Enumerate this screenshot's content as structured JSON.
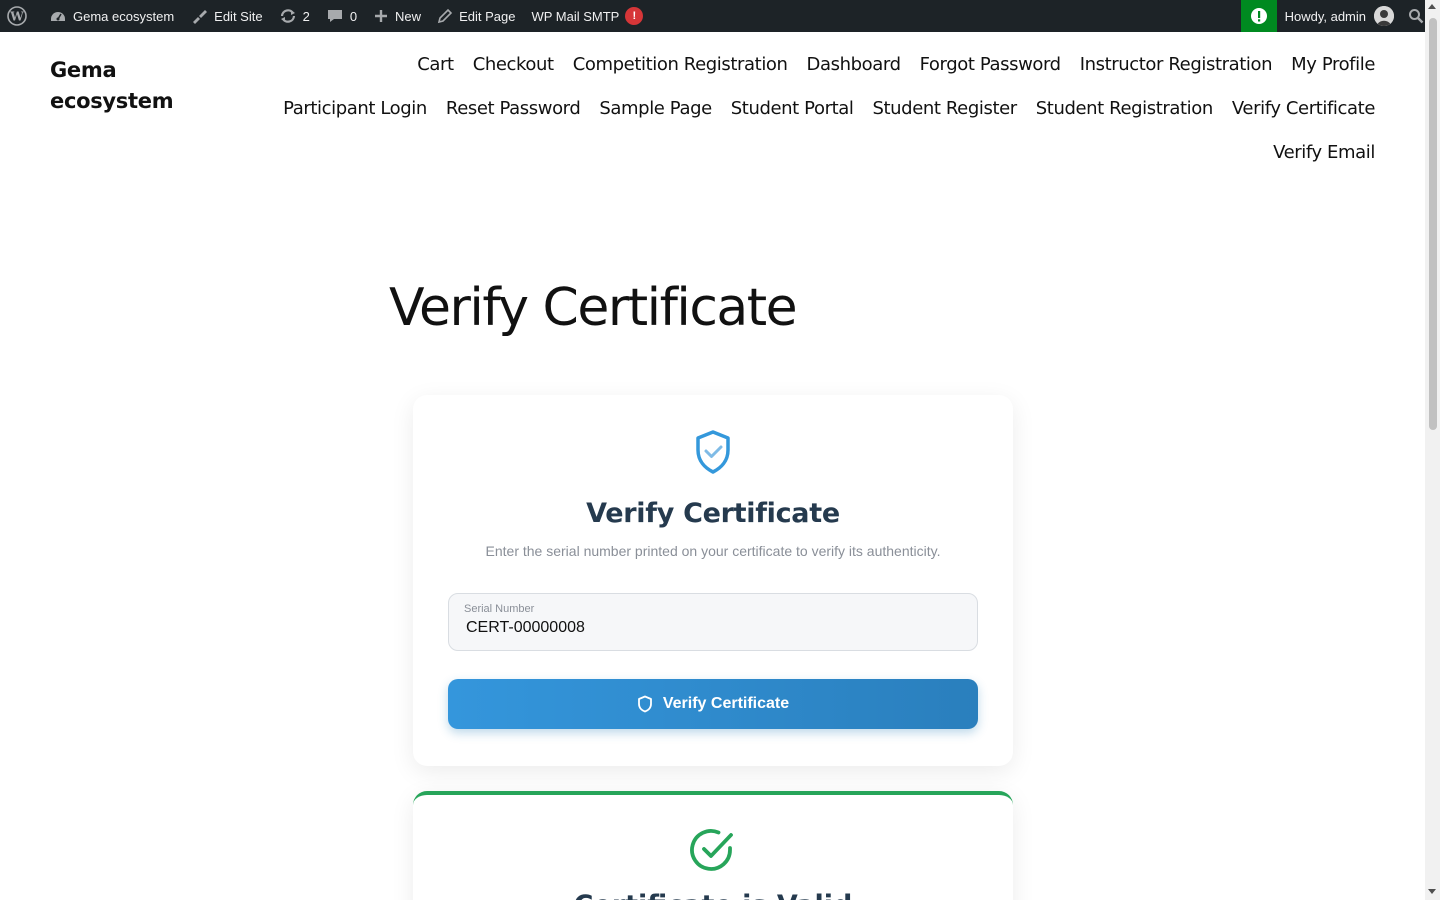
{
  "adminbar": {
    "site_name": "Gema ecosystem",
    "edit_site": "Edit Site",
    "updates_count": "2",
    "comments_count": "0",
    "new_label": "New",
    "edit_page": "Edit Page",
    "smtp_label": "WP Mail SMTP",
    "smtp_badge": "!",
    "howdy": "Howdy, admin"
  },
  "site": {
    "title": "Gema ecosystem"
  },
  "nav": {
    "items": [
      "Cart",
      "Checkout",
      "Competition Registration",
      "Dashboard",
      "Forgot Password",
      "Instructor Registration",
      "My Profile",
      "Participant Login",
      "Reset Password",
      "Sample Page",
      "Student Portal",
      "Student Register",
      "Student Registration",
      "Verify Certificate",
      "Verify Email"
    ]
  },
  "page": {
    "title": "Verify Certificate"
  },
  "verify_card": {
    "title": "Verify Certificate",
    "subtitle": "Enter the serial number printed on your certificate to verify its authenticity.",
    "field_label": "Serial Number",
    "field_value": "CERT-00000008",
    "button_label": "Verify Certificate"
  },
  "result_card": {
    "title": "Certificate is Valid"
  },
  "colors": {
    "accent": "#3498db",
    "success": "#27a55a",
    "title": "#253a4e"
  }
}
